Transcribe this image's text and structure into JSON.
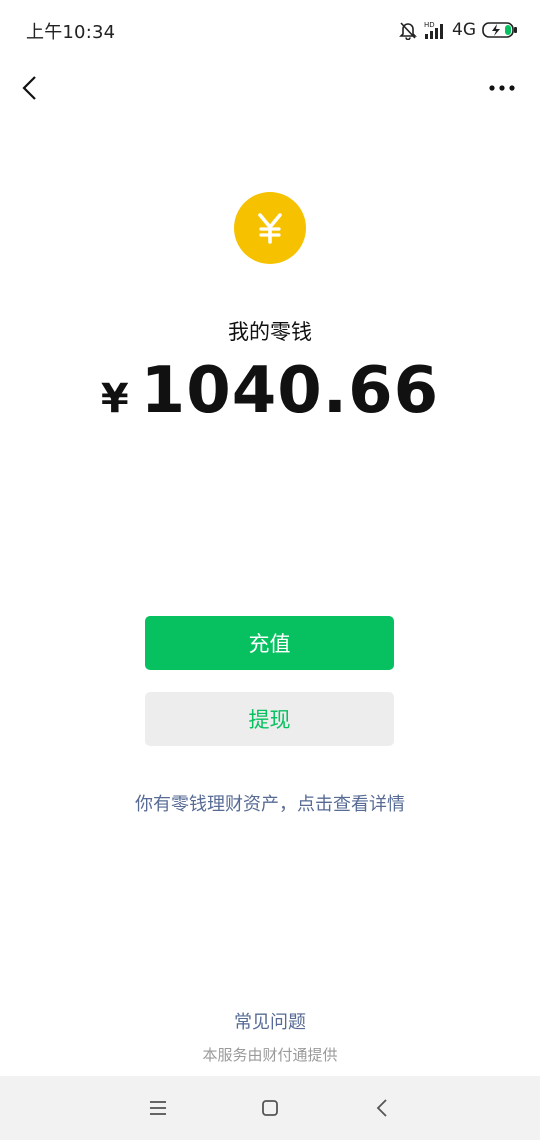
{
  "status_bar": {
    "time": "上午10:34",
    "network": "4G",
    "icons": [
      "bell-off-icon",
      "signal-icon",
      "battery-charging-icon"
    ]
  },
  "nav": {
    "back_icon": "chevron-left-icon",
    "more_icon": "more-dots-icon"
  },
  "wallet": {
    "icon": "yuan-coin-icon",
    "coin_symbol": "¥",
    "title": "我的零钱",
    "currency": "¥",
    "amount": "1040.66"
  },
  "actions": {
    "recharge_label": "充值",
    "withdraw_label": "提现"
  },
  "finance_link": "你有零钱理财资产，点击查看详情",
  "footer": {
    "faq": "常见问题",
    "provider": "本服务由财付通提供"
  },
  "system_nav": {
    "icons": [
      "menu-icon",
      "home-icon",
      "back-icon"
    ]
  },
  "colors": {
    "primary": "#07c160",
    "coin": "#f6c200",
    "link": "#576b95",
    "secondary_bg": "#ededed"
  }
}
